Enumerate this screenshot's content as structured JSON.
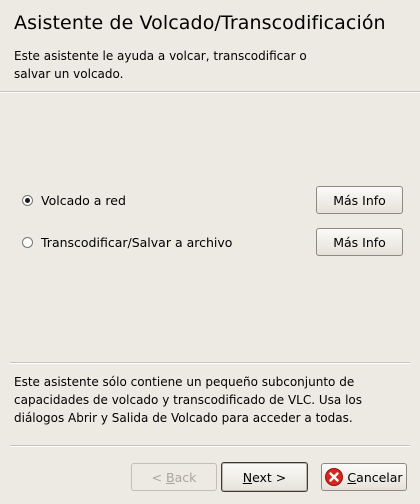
{
  "window": {
    "title": "Asistente de Volcado/Transcodificación",
    "subtitle": "Este asistente le ayuda a volcar, transcodificar o salvar un volcado."
  },
  "options": [
    {
      "label": "Volcado a red",
      "checked": true,
      "info_label": "Más Info"
    },
    {
      "label": "Transcodificar/Salvar a archivo",
      "checked": false,
      "info_label": "Más Info"
    }
  ],
  "footer": {
    "note": "Este asistente sólo contiene un pequeño subconjunto de capacidades de volcado y transcodificado de VLC. Usa los diálogos Abrir y Salida de Volcado para acceder a todas."
  },
  "buttons": {
    "back_prefix": "< ",
    "back_mnemonic": "B",
    "back_rest": "ack",
    "next_mnemonic": "N",
    "next_rest": "ext >",
    "cancel_mnemonic": "C",
    "cancel_rest": "ancelar"
  },
  "colors": {
    "background": "#edeae3",
    "cancel_icon": "#d8261c"
  }
}
